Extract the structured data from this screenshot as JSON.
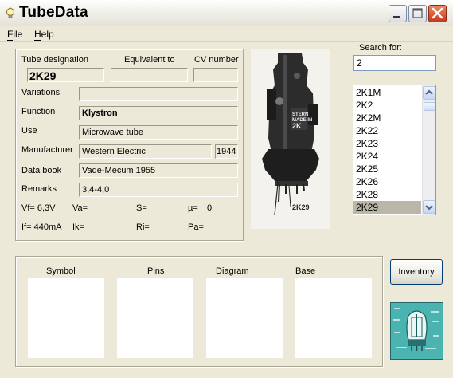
{
  "window": {
    "title": "TubeData"
  },
  "menu": {
    "file": "File",
    "help": "Help"
  },
  "details": {
    "tube_designation_label": "Tube designation",
    "tube_designation_value": "2K29",
    "equivalent_label": "Equivalent to",
    "equivalent_value": "",
    "cv_label": "CV number",
    "cv_value": "",
    "variations_label": "Variations",
    "variations_value": "",
    "function_label": "Function",
    "function_value": "Klystron",
    "use_label": "Use",
    "use_value": "Microwave tube",
    "manufacturer_label": "Manufacturer",
    "manufacturer_value": "Western Electric",
    "year_value": "1944",
    "databook_label": "Data book",
    "databook_value": "Vade-Mecum 1955",
    "remarks_label": "Remarks",
    "remarks_value": "3,4-4,0",
    "vf": "Vf= 6,3V",
    "va": "Va=",
    "s": "S=",
    "mu": "µ=",
    "mu_value": "0",
    "if": "If= 440mA",
    "ik": "Ik=",
    "ri": "Ri=",
    "pa": "Pa="
  },
  "photo": {
    "caption": "2K29",
    "stamp_line1": "STERN",
    "stamp_line2": "MADE IN",
    "stamp_line3": "2K"
  },
  "search": {
    "label": "Search for:",
    "value": "2"
  },
  "tube_list": {
    "items": [
      "2K1M",
      "2K2",
      "2K2M",
      "2K22",
      "2K23",
      "2K24",
      "2K25",
      "2K26",
      "2K28",
      "2K29"
    ],
    "selected_index": 9
  },
  "bottom": {
    "symbol_label": "Symbol",
    "pins_label": "Pins",
    "diagram_label": "Diagram",
    "base_label": "Base"
  },
  "buttons": {
    "inventory": "Inventory"
  }
}
